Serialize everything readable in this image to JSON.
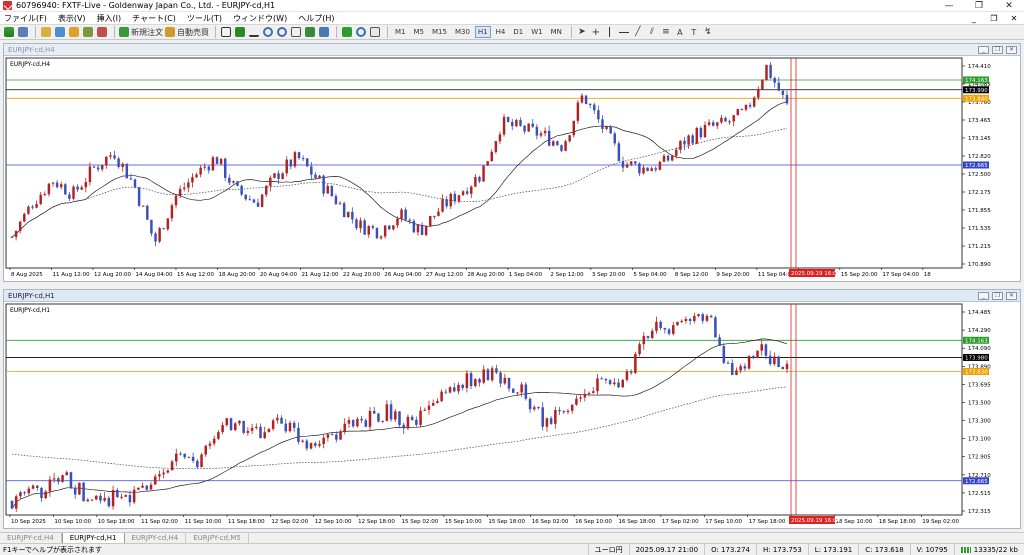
{
  "window": {
    "title": "60796940: FXTF-Live - Goldenway Japan Co., Ltd. - EURJPY-cd,H1",
    "controls": [
      "—",
      "❐",
      "✕"
    ]
  },
  "menu": {
    "items": [
      "ファイル(F)",
      "表示(V)",
      "挿入(I)",
      "チャート(C)",
      "ツール(T)",
      "ウィンドウ(W)",
      "ヘルプ(H)"
    ],
    "right_controls": [
      "_",
      "❐",
      "✕"
    ]
  },
  "toolbar": {
    "new_order": "新規注文",
    "auto_trading": "自動売買",
    "timeframes": [
      "M1",
      "M5",
      "M15",
      "M30",
      "H1",
      "H4",
      "D1",
      "W1",
      "MN"
    ],
    "active_timeframe": "H1",
    "text_tool": "A",
    "label_tool": "T"
  },
  "charts": [
    {
      "window_title": "EURJPY-cd,H4",
      "label": "EURJPY-cd,H4",
      "y_ticks": [
        "174.410",
        "174.085",
        "173.760",
        "173.465",
        "173.145",
        "172.820",
        "172.500",
        "172.175",
        "171.855",
        "171.535",
        "171.215",
        "170.890"
      ],
      "price_labels": [
        {
          "text": "174.163",
          "color": "#2a9d2a"
        },
        {
          "text": "173.990",
          "color": "#000000"
        },
        {
          "text": "173.840",
          "color": "#f0a000"
        },
        {
          "text": "172.665",
          "color": "#3344cc"
        }
      ],
      "x_labels": [
        "8 Aug 2025",
        "11 Aug 12:00",
        "12 Aug 20:00",
        "14 Aug 04:00",
        "15 Aug 12:00",
        "18 Aug 20:00",
        "20 Aug 04:00",
        "21 Aug 12:00",
        "22 Aug 20:00",
        "26 Aug 04:00",
        "27 Aug 12:00",
        "28 Aug 20:00",
        "1 Sep 04:00",
        "2 Sep 12:00",
        "3 Sep 20:00",
        "5 Sep 04:00",
        "8 Sep 12:00",
        "9 Sep 20:00",
        "11 Sep 04:00",
        "12 Sep 12:00",
        "15 Sep 20:00",
        "17 Sep 04:00",
        "18"
      ],
      "time_marker": "2025.09.19 16:00",
      "chart_data": {
        "type": "candlestick",
        "symbol": "EURJPY-cd",
        "timeframe": "H4",
        "ylim": [
          170.85,
          174.55
        ],
        "hlines": [
          {
            "value": 174.163,
            "color": "#2a9d2a"
          },
          {
            "value": 173.99,
            "color": "#000000"
          },
          {
            "value": 173.84,
            "color": "#f0a000"
          },
          {
            "value": 172.665,
            "color": "#3344cc"
          }
        ],
        "anchors": [
          171.4,
          172.0,
          172.4,
          172.15,
          172.6,
          172.9,
          172.3,
          171.3,
          172.1,
          172.5,
          172.8,
          172.2,
          172.0,
          172.5,
          172.8,
          172.4,
          172.0,
          171.6,
          171.5,
          171.8,
          171.5,
          171.9,
          172.2,
          172.5,
          173.4,
          173.3,
          173.2,
          173.0,
          173.9,
          173.3,
          172.7,
          172.6,
          172.7,
          173.1,
          173.3,
          173.4,
          173.6,
          174.4,
          173.7
        ],
        "ma_fast_lag": 6,
        "ma_slow_lag": 14,
        "bull_color": "#b22222",
        "bear_color": "#3a50b8"
      }
    },
    {
      "window_title": "EURJPY-cd,H1",
      "label": "EURJPY-cd,H1",
      "y_ticks": [
        "174.485",
        "174.290",
        "174.090",
        "173.890",
        "173.695",
        "173.500",
        "173.300",
        "173.100",
        "172.905",
        "172.710",
        "172.515",
        "172.315"
      ],
      "price_labels": [
        {
          "text": "174.163",
          "color": "#2a9d2a"
        },
        {
          "text": "173.980",
          "color": "#000000"
        },
        {
          "text": "173.830",
          "color": "#f0a000"
        },
        {
          "text": "172.665",
          "color": "#3344cc"
        }
      ],
      "x_labels": [
        "10 Sep 2025",
        "10 Sep 10:00",
        "10 Sep 18:00",
        "11 Sep 02:00",
        "11 Sep 10:00",
        "11 Sep 18:00",
        "12 Sep 02:00",
        "12 Sep 10:00",
        "12 Sep 18:00",
        "15 Sep 02:00",
        "15 Sep 10:00",
        "15 Sep 18:00",
        "16 Sep 02:00",
        "16 Sep 10:00",
        "16 Sep 18:00",
        "17 Sep 02:00",
        "17 Sep 10:00",
        "17 Sep 18:00",
        "18 Sep 02:00",
        "18 Sep 10:00",
        "18 Sep 18:00",
        "19 Sep 02:00"
      ],
      "time_marker": "2025.09.19 16:00",
      "chart_data": {
        "type": "candlestick",
        "symbol": "EURJPY-cd",
        "timeframe": "H1",
        "ylim": [
          172.3,
          174.55
        ],
        "hlines": [
          {
            "value": 174.163,
            "color": "#2a9d2a"
          },
          {
            "value": 173.98,
            "color": "#000000"
          },
          {
            "value": 173.83,
            "color": "#f0a000"
          },
          {
            "value": 172.665,
            "color": "#3344cc"
          }
        ],
        "anchors": [
          172.45,
          172.55,
          172.7,
          172.45,
          172.5,
          172.55,
          172.9,
          172.85,
          173.3,
          173.15,
          173.3,
          173.05,
          173.15,
          173.3,
          173.4,
          173.25,
          173.55,
          173.75,
          173.8,
          173.65,
          173.25,
          173.55,
          173.7,
          173.75,
          174.35,
          174.3,
          174.45,
          173.75,
          174.05,
          173.9
        ],
        "ma_fast_lag": 10,
        "ma_slow_lag": 30,
        "slow_start": 172.95,
        "bull_color": "#b22222",
        "bear_color": "#3a50b8"
      }
    }
  ],
  "tabs": [
    "EURJPY-cd,H4",
    "EURJPY-cd,H1",
    "EURJPY-cd,H4",
    "EURJPY-cd,M5"
  ],
  "active_tab": 1,
  "status": {
    "help": "F1キーでヘルプが表示されます",
    "profile": "ユーロ円",
    "datetime": "2025.09.17 21:00",
    "open": "O: 173.274",
    "high": "H: 173.753",
    "low": "L: 173.191",
    "close": "C: 173.618",
    "volume": "V: 10795",
    "traffic": "13335/22 kb"
  }
}
